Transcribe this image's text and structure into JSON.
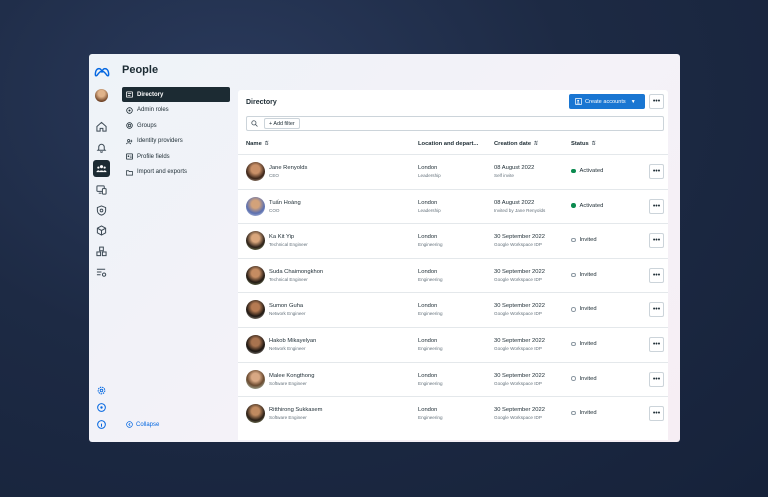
{
  "app": {
    "page_title": "People"
  },
  "subnav": [
    {
      "label": "Directory",
      "icon": "directory-icon",
      "active": true
    },
    {
      "label": "Admin roles",
      "icon": "admin-roles-icon"
    },
    {
      "label": "Groups",
      "icon": "groups-icon"
    },
    {
      "label": "Identity providers",
      "icon": "identity-icon"
    },
    {
      "label": "Profile fields",
      "icon": "profile-fields-icon"
    },
    {
      "label": "Import and exports",
      "icon": "import-export-icon"
    }
  ],
  "collapse_label": "Collapse",
  "directory": {
    "title": "Directory",
    "create_label": "Create accounts",
    "more_label": "•••",
    "add_filter_label": "+ Add filter",
    "columns": [
      "Name",
      "Location and depart...",
      "Creation date",
      "Status"
    ],
    "rows": [
      {
        "name": "Jane Renyolds",
        "title": "CEO",
        "location": "London",
        "dept": "Leadership",
        "date": "08 August 2022",
        "source": "Self invite",
        "status": "Activated"
      },
      {
        "name": "Tuấn Hoàng",
        "title": "COO",
        "location": "London",
        "dept": "Leadership",
        "date": "08 August 2022",
        "source": "Invited by Jane Renyolds",
        "status": "Activated"
      },
      {
        "name": "Ka Kit Yip",
        "title": "Technical Engineer",
        "location": "London",
        "dept": "Engineering",
        "date": "30 September 2022",
        "source": "Google Workspace IDP",
        "status": "Invited"
      },
      {
        "name": "Suda Chaimongkhon",
        "title": "Technical Engineer",
        "location": "London",
        "dept": "Engineering",
        "date": "30 September 2022",
        "source": "Google Workspace IDP",
        "status": "Invited"
      },
      {
        "name": "Sumon Guha",
        "title": "Network Engineer",
        "location": "London",
        "dept": "Engineering",
        "date": "30 September 2022",
        "source": "Google Workspace IDP",
        "status": "Invited"
      },
      {
        "name": "Hakob Mikayelyan",
        "title": "Network Engineer",
        "location": "London",
        "dept": "Engineering",
        "date": "30 September 2022",
        "source": "Google Workspace IDP",
        "status": "Invited"
      },
      {
        "name": "Malee Kongthong",
        "title": "Software Engineer",
        "location": "London",
        "dept": "Engineering",
        "date": "30 September 2022",
        "source": "Google Workspace IDP",
        "status": "Invited"
      },
      {
        "name": "Ritthirong Sukkasem",
        "title": "Software Engineer",
        "location": "London",
        "dept": "Engineering",
        "date": "30 September 2022",
        "source": "Google Workspace IDP",
        "status": "Invited"
      }
    ]
  },
  "colors": {
    "accent": "#1976d2",
    "activated": "#0b8a4f",
    "nav_active": "#1c2b33"
  }
}
